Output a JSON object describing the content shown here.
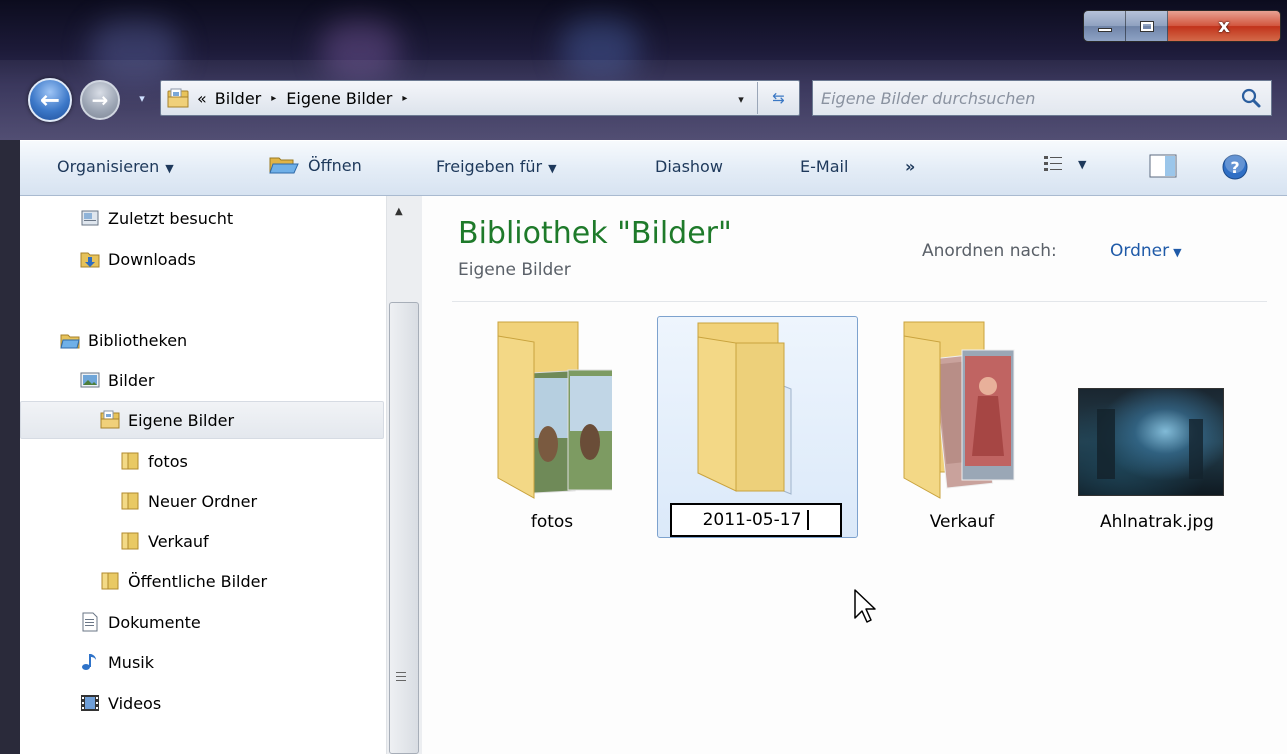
{
  "window": {
    "caption_buttons": {
      "minimize": "",
      "maximize": "",
      "close": "x"
    },
    "accent_color": "#1e7a2a"
  },
  "nav_buttons": {
    "back_icon": "arrow-left-icon",
    "forward_icon": "arrow-right-icon"
  },
  "address_bar": {
    "overflow": "«",
    "crumbs": [
      "Bilder",
      "Eigene Bilder"
    ],
    "separator": "▸",
    "dropdown": "▾",
    "refresh_icon": "refresh-icon"
  },
  "search": {
    "placeholder": "Eigene Bilder durchsuchen",
    "icon": "magnifier-icon"
  },
  "toolbar": {
    "organize": "Organisieren",
    "open": "Öffnen",
    "share": "Freigeben für",
    "slideshow": "Diashow",
    "email": "E-Mail",
    "more": "»",
    "dropdown_arrow": "▼"
  },
  "navigation": {
    "recent": "Zuletzt besucht",
    "downloads": "Downloads",
    "libraries": "Bibliotheken",
    "pictures": "Bilder",
    "my_pictures": "Eigene Bilder",
    "fotos": "fotos",
    "new_folder": "Neuer Ordner",
    "verkauf": "Verkauf",
    "public_pictures": "Öffentliche Bilder",
    "documents": "Dokumente",
    "music": "Musik",
    "videos": "Videos"
  },
  "content": {
    "title": "Bibliothek \"Bilder\"",
    "subtitle": "Eigene Bilder",
    "arrange_label": "Anordnen nach:",
    "arrange_value": "Ordner",
    "arrange_arrow": "▼",
    "items": [
      {
        "name": "fotos",
        "type": "folder-with-photos"
      },
      {
        "name": "2011-05-17",
        "type": "folder",
        "state": "renaming"
      },
      {
        "name": "Verkauf",
        "type": "folder-with-photos"
      },
      {
        "name": "Ahlnatrak.jpg",
        "type": "image"
      }
    ]
  }
}
